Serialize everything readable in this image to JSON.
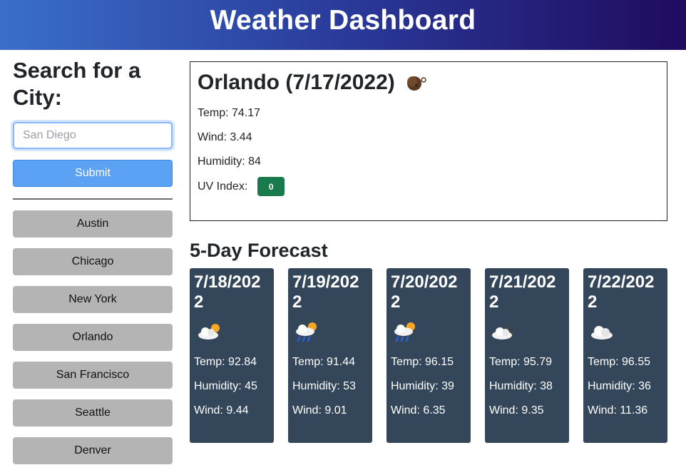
{
  "header": {
    "title": "Weather Dashboard"
  },
  "sidebar": {
    "heading": "Search for a City:",
    "search": {
      "placeholder": "San Diego",
      "value": ""
    },
    "submit_label": "Submit",
    "cities": [
      "Austin",
      "Chicago",
      "New York",
      "Orlando",
      "San Francisco",
      "Seattle",
      "Denver"
    ]
  },
  "current": {
    "title": "Orlando (7/17/2022)",
    "icon": "moon-icon",
    "temp": "Temp: 74.17",
    "wind": "Wind: 3.44",
    "humidity": "Humidity: 84",
    "uv_label": "UV Index:",
    "uv_value": "0",
    "uv_color": "#197a4e"
  },
  "forecast": {
    "title": "5-Day Forecast",
    "days": [
      {
        "date": "7/18/2022",
        "icon": "partly-cloudy-sun-icon",
        "temp": "Temp: 92.84",
        "humidity": "Humidity: 45",
        "wind": "Wind: 9.44"
      },
      {
        "date": "7/19/2022",
        "icon": "rain-sun-icon",
        "temp": "Temp: 91.44",
        "humidity": "Humidity: 53",
        "wind": "Wind: 9.01"
      },
      {
        "date": "7/20/2022",
        "icon": "rain-sun-icon",
        "temp": "Temp: 96.15",
        "humidity": "Humidity: 39",
        "wind": "Wind: 6.35"
      },
      {
        "date": "7/21/2022",
        "icon": "cloud-moon-icon",
        "temp": "Temp: 95.79",
        "humidity": "Humidity: 38",
        "wind": "Wind: 9.35"
      },
      {
        "date": "7/22/2022",
        "icon": "cloud-icon",
        "temp": "Temp: 96.55",
        "humidity": "Humidity: 36",
        "wind": "Wind: 11.36"
      }
    ]
  },
  "colors": {
    "header_start": "#3a6fc8",
    "header_end": "#1f0b5e",
    "submit": "#5ba2f4",
    "city_button": "#b4b4b4",
    "card": "#34475a"
  }
}
